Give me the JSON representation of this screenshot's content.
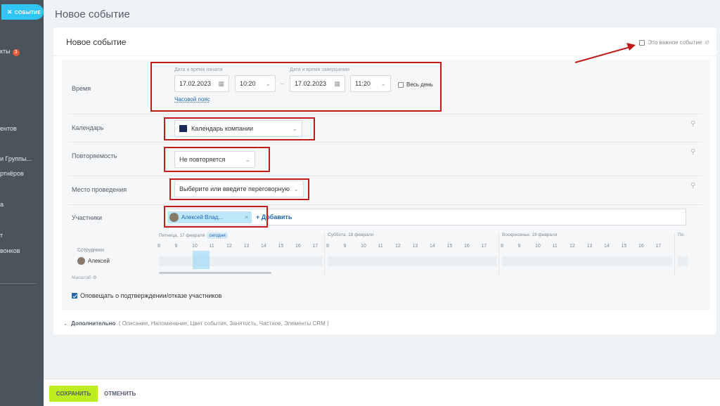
{
  "sidebar": {
    "event_chip": "СОБЫТИЕ",
    "items": [
      {
        "label": "кты"
      },
      {
        "label": "ентов"
      },
      {
        "label": "и Группы..."
      },
      {
        "label": "ртнёров"
      },
      {
        "label": "а"
      },
      {
        "label": "т"
      },
      {
        "label": "вонков"
      }
    ],
    "badge": "3"
  },
  "page": {
    "title": "Новое событие"
  },
  "form": {
    "title": "Новое событие",
    "important_label": "Это важное событие",
    "time": {
      "label": "Время",
      "start_caption": "Дата и время начала",
      "end_caption": "Дата и время завершения",
      "start_date": "17.02.2023",
      "start_time": "10:20",
      "end_date": "17.02.2023",
      "end_time": "11:20",
      "all_day_label": "Весь день",
      "timezone_link": "Часовой пояс"
    },
    "calendar": {
      "label": "Календарь",
      "value": "Календарь компании",
      "swatch_color": "#1b2c5c"
    },
    "repeat": {
      "label": "Повторяемость",
      "value": "Не повторяется"
    },
    "location": {
      "label": "Место проведения",
      "placeholder": "Выберите или введите переговорную"
    },
    "participants": {
      "label": "Участники",
      "chip_name": "Алексей Влад...",
      "add_label": "+ Добавить"
    },
    "timeline": {
      "days": [
        {
          "label": "Пятница, 17 февраля",
          "badge": "сегодня"
        },
        {
          "label": "Суббота, 18 февраля"
        },
        {
          "label": "Воскресенье, 19 февраля"
        },
        {
          "label": "По"
        }
      ],
      "hours": [
        "8",
        "9",
        "10",
        "11",
        "12",
        "13",
        "14",
        "15",
        "16",
        "17"
      ],
      "employees_label": "Сотрудники",
      "employee_name": "Алексей",
      "scale_label": "Масштаб"
    },
    "notify_label": "Оповещать о подтверждении/отказе участников",
    "more": {
      "label": "Дополнительно",
      "items": "( Описание,  Напоминание,  Цвет события,  Занятость,  Частное,  Элементы CRM )"
    }
  },
  "footer": {
    "save": "СОХРАНИТЬ",
    "cancel": "ОТМЕНИТЬ"
  },
  "colors": {
    "accent": "#2fc6f6",
    "save": "#bbed21",
    "annotation": "#c01a1a",
    "link": "#2067b0"
  }
}
